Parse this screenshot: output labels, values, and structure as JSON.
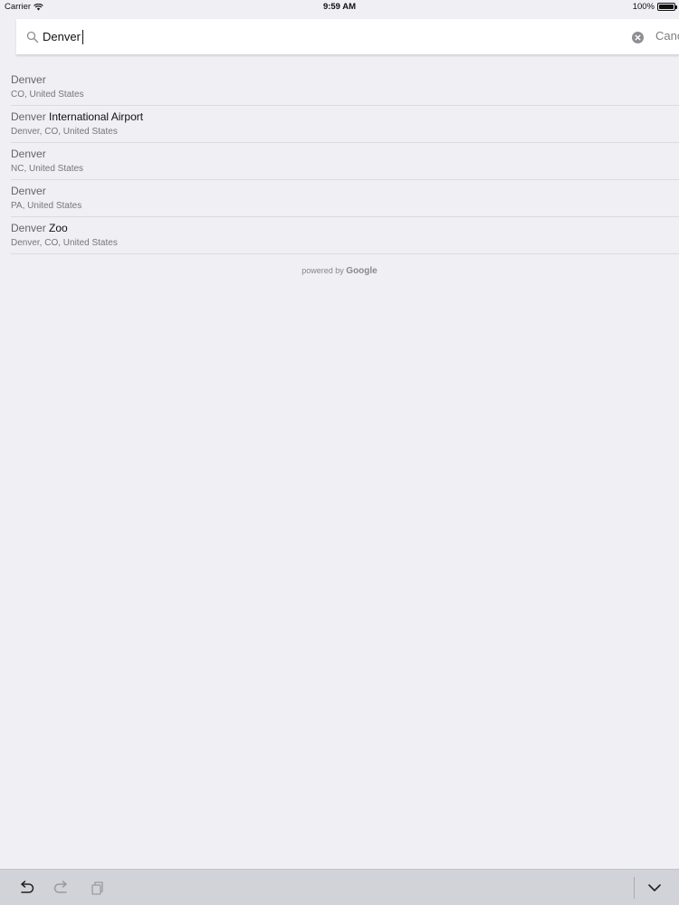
{
  "status_bar": {
    "carrier": "Carrier",
    "time": "9:59 AM",
    "battery": "100%"
  },
  "search": {
    "query": "Denver",
    "cancel_label": "Cancel"
  },
  "results": [
    {
      "title_match": "Denver",
      "title_extra": "",
      "subtitle": "CO, United States"
    },
    {
      "title_match": "Denver",
      "title_extra": " International Airport",
      "subtitle": "Denver, CO, United States"
    },
    {
      "title_match": "Denver",
      "title_extra": "",
      "subtitle": "NC, United States"
    },
    {
      "title_match": "Denver",
      "title_extra": "",
      "subtitle": "PA, United States"
    },
    {
      "title_match": "Denver",
      "title_extra": " Zoo",
      "subtitle": "Denver, CO, United States"
    }
  ],
  "attribution": {
    "prefix": "powered by",
    "brand": "Google"
  },
  "toolbar": {
    "icons": [
      "undo-icon",
      "redo-icon",
      "paste-icon",
      "dismiss-keyboard-icon"
    ]
  },
  "colors": {
    "background": "#efeff4",
    "search_bg": "#ffffff",
    "toolbar_bg": "#d1d3d8"
  }
}
